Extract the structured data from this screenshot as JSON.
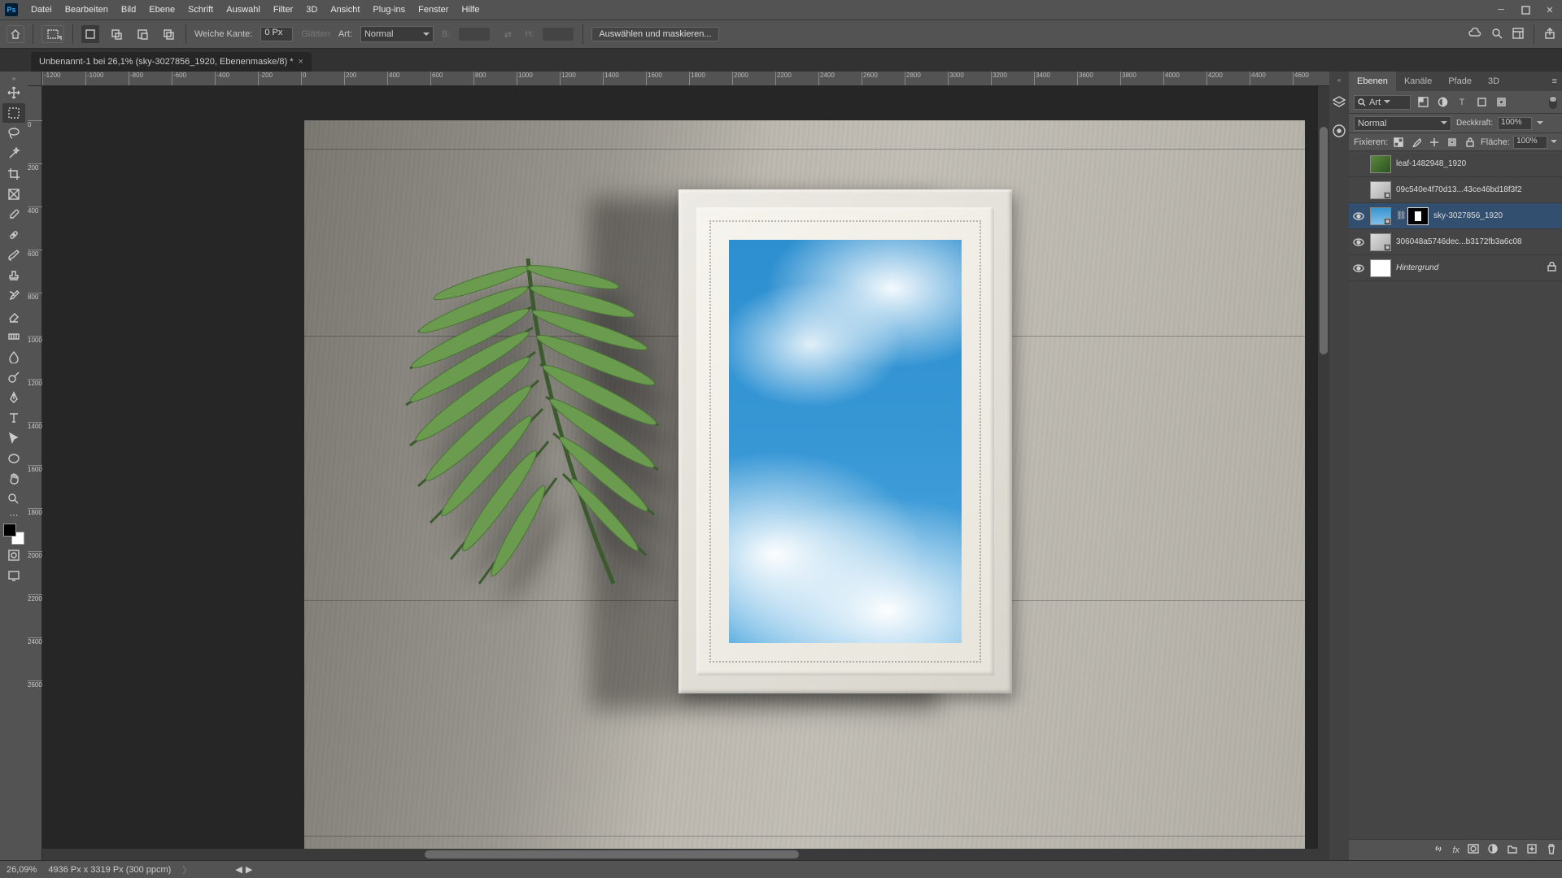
{
  "menu": {
    "items": [
      "Datei",
      "Bearbeiten",
      "Bild",
      "Ebene",
      "Schrift",
      "Auswahl",
      "Filter",
      "3D",
      "Ansicht",
      "Plug-ins",
      "Fenster",
      "Hilfe"
    ]
  },
  "options": {
    "feather_label": "Weiche Kante:",
    "feather_value": "0 Px",
    "antialias": "Glätten",
    "style_label": "Art:",
    "style_value": "Normal",
    "width_label": "B:",
    "width_value": "",
    "height_label": "H:",
    "height_value": "",
    "refine": "Auswählen und maskieren..."
  },
  "doc_tab": "Unbenannt-1 bei 26,1% (sky-3027856_1920, Ebenenmaske/8) *",
  "ruler_h": [
    "-1200",
    "-1000",
    "-800",
    "-600",
    "-400",
    "-200",
    "0",
    "200",
    "400",
    "600",
    "800",
    "1000",
    "1200",
    "1400",
    "1600",
    "1800",
    "2000",
    "2200",
    "2400",
    "2600",
    "2800",
    "3000",
    "3200",
    "3400",
    "3600",
    "3800",
    "4000",
    "4200",
    "4400",
    "4600"
  ],
  "ruler_v": [
    "0",
    "200",
    "400",
    "600",
    "800",
    "1000",
    "1200",
    "1400",
    "1600",
    "1800",
    "2000",
    "2200",
    "2400",
    "2600"
  ],
  "panels": {
    "tabs": [
      "Ebenen",
      "Kanäle",
      "Pfade",
      "3D"
    ],
    "filter": "Art",
    "mode": "Normal",
    "opacity_label": "Deckkraft:",
    "opacity": "100%",
    "fill_label": "Fläche:",
    "fill": "100%",
    "lock_label": "Fixieren:"
  },
  "layers": [
    {
      "visible": false,
      "name": "leaf-1482948_1920",
      "thumb": "leaf",
      "mask": false,
      "smart": false,
      "lock": false,
      "italic": false
    },
    {
      "visible": false,
      "name": "09c540e4f70d13...43ce46bd18f3f2",
      "thumb": "frame",
      "mask": false,
      "smart": true,
      "lock": false,
      "italic": false
    },
    {
      "visible": true,
      "name": "sky-3027856_1920",
      "thumb": "sky",
      "mask": true,
      "smart": true,
      "lock": false,
      "italic": false,
      "selected": true
    },
    {
      "visible": true,
      "name": "306048a5746dec...b3172fb3a6c08",
      "thumb": "frame",
      "mask": false,
      "smart": true,
      "lock": false,
      "italic": false
    },
    {
      "visible": true,
      "name": "Hintergrund",
      "thumb": "white",
      "mask": false,
      "smart": false,
      "lock": true,
      "italic": true
    }
  ],
  "status": {
    "zoom": "26,09%",
    "info": "4936 Px x 3319 Px (300 ppcm)"
  }
}
